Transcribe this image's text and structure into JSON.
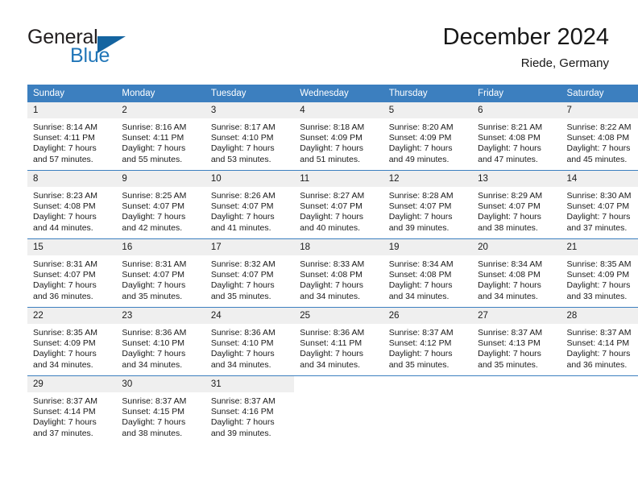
{
  "brand": {
    "name_part1": "General",
    "name_part2": "Blue",
    "accent_color": "#2176b8",
    "triangle_color": "#1464a0"
  },
  "header": {
    "title": "December 2024",
    "subtitle": "Riede, Germany"
  },
  "calendar": {
    "header_bg": "#3c7fbf",
    "daynum_bg": "#efefef",
    "weekdays": [
      "Sunday",
      "Monday",
      "Tuesday",
      "Wednesday",
      "Thursday",
      "Friday",
      "Saturday"
    ],
    "weeks": [
      [
        {
          "day": "1",
          "sunrise": "Sunrise: 8:14 AM",
          "sunset": "Sunset: 4:11 PM",
          "daylight_line1": "Daylight: 7 hours",
          "daylight_line2": "and 57 minutes."
        },
        {
          "day": "2",
          "sunrise": "Sunrise: 8:16 AM",
          "sunset": "Sunset: 4:11 PM",
          "daylight_line1": "Daylight: 7 hours",
          "daylight_line2": "and 55 minutes."
        },
        {
          "day": "3",
          "sunrise": "Sunrise: 8:17 AM",
          "sunset": "Sunset: 4:10 PM",
          "daylight_line1": "Daylight: 7 hours",
          "daylight_line2": "and 53 minutes."
        },
        {
          "day": "4",
          "sunrise": "Sunrise: 8:18 AM",
          "sunset": "Sunset: 4:09 PM",
          "daylight_line1": "Daylight: 7 hours",
          "daylight_line2": "and 51 minutes."
        },
        {
          "day": "5",
          "sunrise": "Sunrise: 8:20 AM",
          "sunset": "Sunset: 4:09 PM",
          "daylight_line1": "Daylight: 7 hours",
          "daylight_line2": "and 49 minutes."
        },
        {
          "day": "6",
          "sunrise": "Sunrise: 8:21 AM",
          "sunset": "Sunset: 4:08 PM",
          "daylight_line1": "Daylight: 7 hours",
          "daylight_line2": "and 47 minutes."
        },
        {
          "day": "7",
          "sunrise": "Sunrise: 8:22 AM",
          "sunset": "Sunset: 4:08 PM",
          "daylight_line1": "Daylight: 7 hours",
          "daylight_line2": "and 45 minutes."
        }
      ],
      [
        {
          "day": "8",
          "sunrise": "Sunrise: 8:23 AM",
          "sunset": "Sunset: 4:08 PM",
          "daylight_line1": "Daylight: 7 hours",
          "daylight_line2": "and 44 minutes."
        },
        {
          "day": "9",
          "sunrise": "Sunrise: 8:25 AM",
          "sunset": "Sunset: 4:07 PM",
          "daylight_line1": "Daylight: 7 hours",
          "daylight_line2": "and 42 minutes."
        },
        {
          "day": "10",
          "sunrise": "Sunrise: 8:26 AM",
          "sunset": "Sunset: 4:07 PM",
          "daylight_line1": "Daylight: 7 hours",
          "daylight_line2": "and 41 minutes."
        },
        {
          "day": "11",
          "sunrise": "Sunrise: 8:27 AM",
          "sunset": "Sunset: 4:07 PM",
          "daylight_line1": "Daylight: 7 hours",
          "daylight_line2": "and 40 minutes."
        },
        {
          "day": "12",
          "sunrise": "Sunrise: 8:28 AM",
          "sunset": "Sunset: 4:07 PM",
          "daylight_line1": "Daylight: 7 hours",
          "daylight_line2": "and 39 minutes."
        },
        {
          "day": "13",
          "sunrise": "Sunrise: 8:29 AM",
          "sunset": "Sunset: 4:07 PM",
          "daylight_line1": "Daylight: 7 hours",
          "daylight_line2": "and 38 minutes."
        },
        {
          "day": "14",
          "sunrise": "Sunrise: 8:30 AM",
          "sunset": "Sunset: 4:07 PM",
          "daylight_line1": "Daylight: 7 hours",
          "daylight_line2": "and 37 minutes."
        }
      ],
      [
        {
          "day": "15",
          "sunrise": "Sunrise: 8:31 AM",
          "sunset": "Sunset: 4:07 PM",
          "daylight_line1": "Daylight: 7 hours",
          "daylight_line2": "and 36 minutes."
        },
        {
          "day": "16",
          "sunrise": "Sunrise: 8:31 AM",
          "sunset": "Sunset: 4:07 PM",
          "daylight_line1": "Daylight: 7 hours",
          "daylight_line2": "and 35 minutes."
        },
        {
          "day": "17",
          "sunrise": "Sunrise: 8:32 AM",
          "sunset": "Sunset: 4:07 PM",
          "daylight_line1": "Daylight: 7 hours",
          "daylight_line2": "and 35 minutes."
        },
        {
          "day": "18",
          "sunrise": "Sunrise: 8:33 AM",
          "sunset": "Sunset: 4:08 PM",
          "daylight_line1": "Daylight: 7 hours",
          "daylight_line2": "and 34 minutes."
        },
        {
          "day": "19",
          "sunrise": "Sunrise: 8:34 AM",
          "sunset": "Sunset: 4:08 PM",
          "daylight_line1": "Daylight: 7 hours",
          "daylight_line2": "and 34 minutes."
        },
        {
          "day": "20",
          "sunrise": "Sunrise: 8:34 AM",
          "sunset": "Sunset: 4:08 PM",
          "daylight_line1": "Daylight: 7 hours",
          "daylight_line2": "and 34 minutes."
        },
        {
          "day": "21",
          "sunrise": "Sunrise: 8:35 AM",
          "sunset": "Sunset: 4:09 PM",
          "daylight_line1": "Daylight: 7 hours",
          "daylight_line2": "and 33 minutes."
        }
      ],
      [
        {
          "day": "22",
          "sunrise": "Sunrise: 8:35 AM",
          "sunset": "Sunset: 4:09 PM",
          "daylight_line1": "Daylight: 7 hours",
          "daylight_line2": "and 34 minutes."
        },
        {
          "day": "23",
          "sunrise": "Sunrise: 8:36 AM",
          "sunset": "Sunset: 4:10 PM",
          "daylight_line1": "Daylight: 7 hours",
          "daylight_line2": "and 34 minutes."
        },
        {
          "day": "24",
          "sunrise": "Sunrise: 8:36 AM",
          "sunset": "Sunset: 4:10 PM",
          "daylight_line1": "Daylight: 7 hours",
          "daylight_line2": "and 34 minutes."
        },
        {
          "day": "25",
          "sunrise": "Sunrise: 8:36 AM",
          "sunset": "Sunset: 4:11 PM",
          "daylight_line1": "Daylight: 7 hours",
          "daylight_line2": "and 34 minutes."
        },
        {
          "day": "26",
          "sunrise": "Sunrise: 8:37 AM",
          "sunset": "Sunset: 4:12 PM",
          "daylight_line1": "Daylight: 7 hours",
          "daylight_line2": "and 35 minutes."
        },
        {
          "day": "27",
          "sunrise": "Sunrise: 8:37 AM",
          "sunset": "Sunset: 4:13 PM",
          "daylight_line1": "Daylight: 7 hours",
          "daylight_line2": "and 35 minutes."
        },
        {
          "day": "28",
          "sunrise": "Sunrise: 8:37 AM",
          "sunset": "Sunset: 4:14 PM",
          "daylight_line1": "Daylight: 7 hours",
          "daylight_line2": "and 36 minutes."
        }
      ],
      [
        {
          "day": "29",
          "sunrise": "Sunrise: 8:37 AM",
          "sunset": "Sunset: 4:14 PM",
          "daylight_line1": "Daylight: 7 hours",
          "daylight_line2": "and 37 minutes."
        },
        {
          "day": "30",
          "sunrise": "Sunrise: 8:37 AM",
          "sunset": "Sunset: 4:15 PM",
          "daylight_line1": "Daylight: 7 hours",
          "daylight_line2": "and 38 minutes."
        },
        {
          "day": "31",
          "sunrise": "Sunrise: 8:37 AM",
          "sunset": "Sunset: 4:16 PM",
          "daylight_line1": "Daylight: 7 hours",
          "daylight_line2": "and 39 minutes."
        },
        {
          "day": "",
          "sunrise": "",
          "sunset": "",
          "daylight_line1": "",
          "daylight_line2": ""
        },
        {
          "day": "",
          "sunrise": "",
          "sunset": "",
          "daylight_line1": "",
          "daylight_line2": ""
        },
        {
          "day": "",
          "sunrise": "",
          "sunset": "",
          "daylight_line1": "",
          "daylight_line2": ""
        },
        {
          "day": "",
          "sunrise": "",
          "sunset": "",
          "daylight_line1": "",
          "daylight_line2": ""
        }
      ]
    ]
  }
}
